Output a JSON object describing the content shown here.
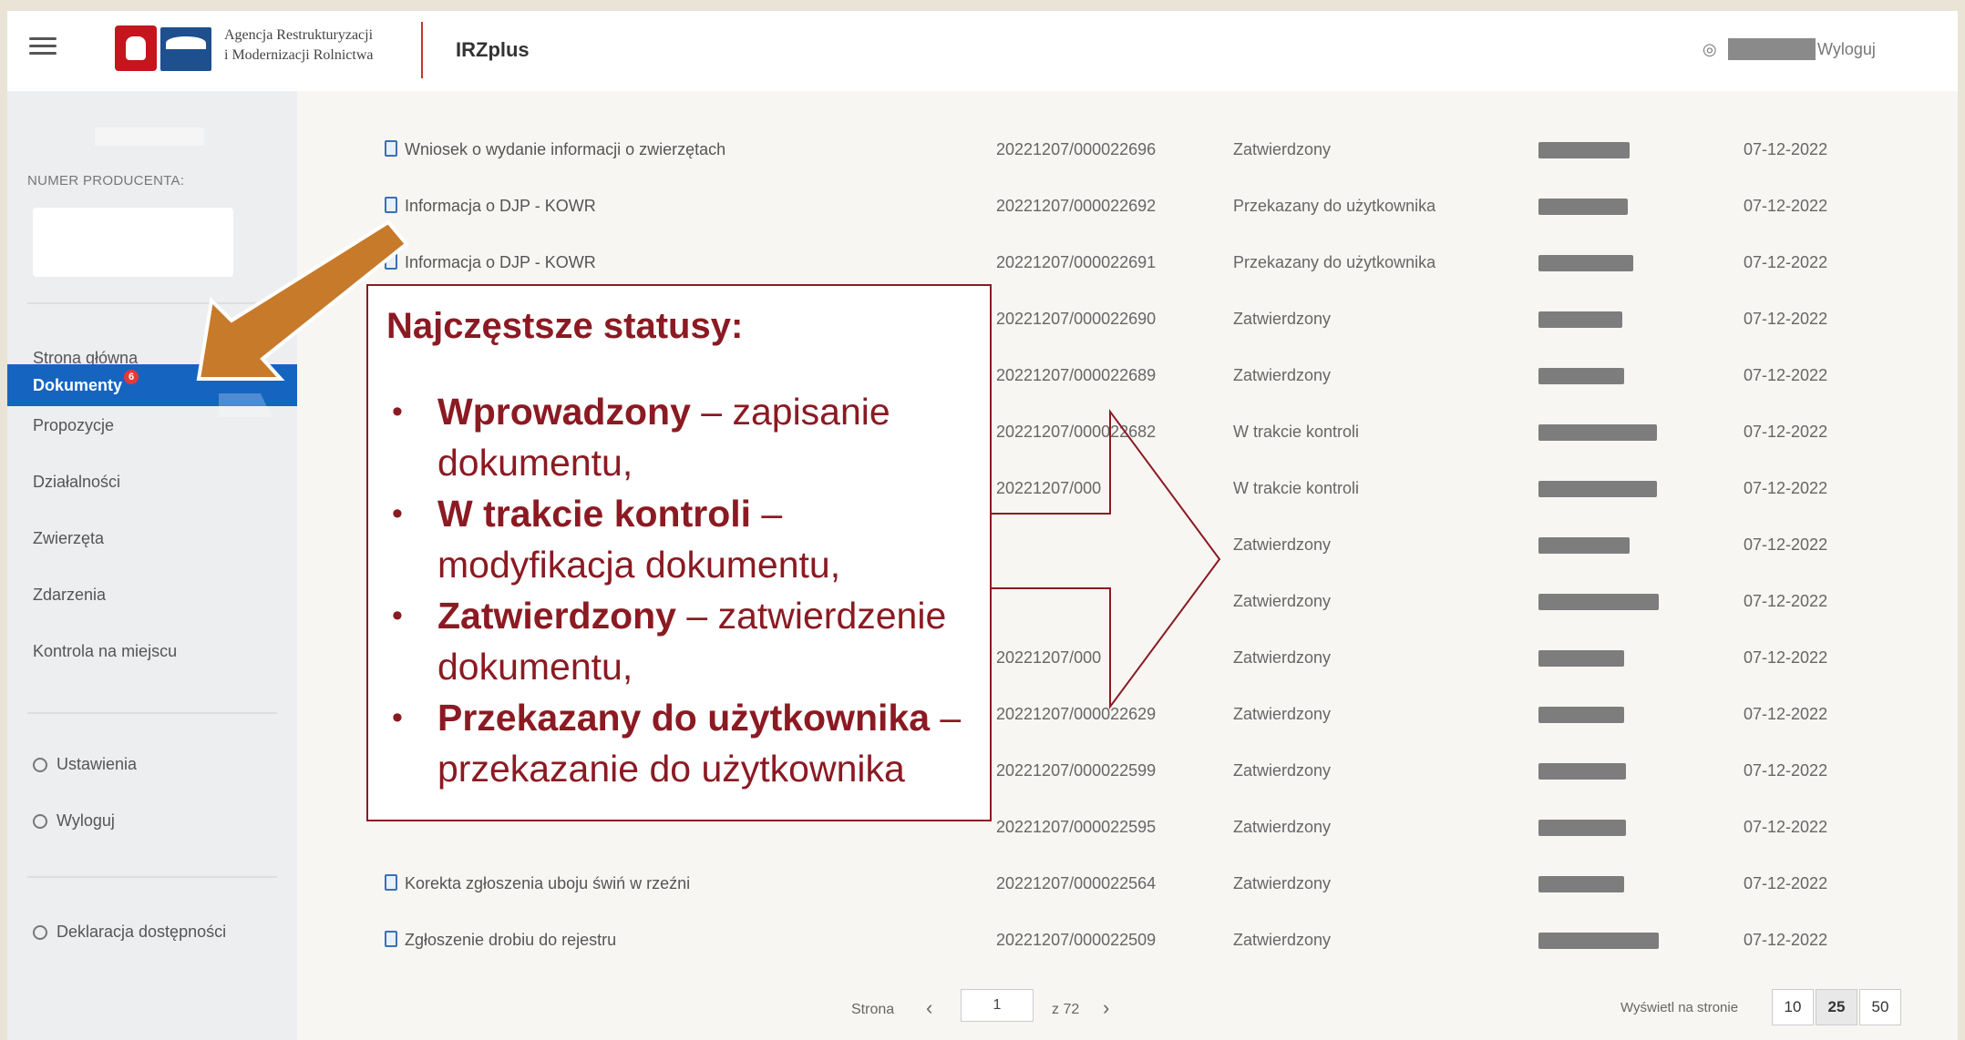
{
  "header": {
    "agency_line1": "Agencja Restrukturyzacji",
    "agency_line2": "i Modernizacji Rolnictwa",
    "app_name": "IRZplus",
    "logout": "Wyloguj"
  },
  "sidebar": {
    "producer_label": "NUMER PRODUCENTA:",
    "items": [
      {
        "label": "Strona główna"
      },
      {
        "label": "Dokumenty",
        "badge": "6"
      },
      {
        "label": "Propozycje"
      },
      {
        "label": "Działalności"
      },
      {
        "label": "Zwierzęta"
      },
      {
        "label": "Zdarzenia"
      },
      {
        "label": "Kontrola na miejscu"
      },
      {
        "label": "Ustawienia"
      },
      {
        "label": "Wyloguj"
      },
      {
        "label": "Deklaracja dostępności"
      }
    ]
  },
  "table": {
    "rows": [
      {
        "name": "Wniosek o wydanie informacji o zwierzętach",
        "number": "20221207/000022696",
        "status": "Zatwierdzony",
        "date": "07-12-2022"
      },
      {
        "name": "Informacja o DJP - KOWR",
        "number": "20221207/000022692",
        "status": "Przekazany do użytkownika",
        "date": "07-12-2022"
      },
      {
        "name": "Informacja o DJP - KOWR",
        "number": "20221207/000022691",
        "status": "Przekazany do użytkownika",
        "date": "07-12-2022"
      },
      {
        "name": "",
        "number": "20221207/000022690",
        "status": "Zatwierdzony",
        "date": "07-12-2022"
      },
      {
        "name": "",
        "number": "20221207/000022689",
        "status": "Zatwierdzony",
        "date": "07-12-2022"
      },
      {
        "name": "",
        "number": "20221207/000022682",
        "status": "W trakcie kontroli",
        "date": "07-12-2022"
      },
      {
        "name": "",
        "number": "20221207/000",
        "status": "W trakcie kontroli",
        "date": "07-12-2022"
      },
      {
        "name": "",
        "number": "",
        "status": "Zatwierdzony",
        "date": "07-12-2022"
      },
      {
        "name": "",
        "number": "",
        "status": "Zatwierdzony",
        "date": "07-12-2022"
      },
      {
        "name": "",
        "number": "20221207/000",
        "status": "Zatwierdzony",
        "date": "07-12-2022"
      },
      {
        "name": "",
        "number": "20221207/000022629",
        "status": "Zatwierdzony",
        "date": "07-12-2022"
      },
      {
        "name": "",
        "number": "20221207/000022599",
        "status": "Zatwierdzony",
        "date": "07-12-2022"
      },
      {
        "name": "",
        "number": "20221207/000022595",
        "status": "Zatwierdzony",
        "date": "07-12-2022"
      },
      {
        "name": "Korekta zgłoszenia uboju świń w rzeźni",
        "number": "20221207/000022564",
        "status": "Zatwierdzony",
        "date": "07-12-2022"
      },
      {
        "name": "Zgłoszenie drobiu do rejestru",
        "number": "20221207/000022509",
        "status": "Zatwierdzony",
        "date": "07-12-2022"
      }
    ]
  },
  "pagination": {
    "page_label": "Strona",
    "current_page": "1",
    "total": "z 72",
    "per_page_label": "Wyświetl na stronie",
    "options": [
      "10",
      "25",
      "50"
    ],
    "selected": "25"
  },
  "callout": {
    "title": "Najczęstsze statusy:",
    "items": [
      {
        "term": "Wprowadzony",
        "sep": " – ",
        "desc": "zapisanie dokumentu,"
      },
      {
        "term": "W trakcie kontroli",
        "sep": " – ",
        "desc": "modyfikacja dokumentu,"
      },
      {
        "term": "Zatwierdzony",
        "sep": " – ",
        "desc": "zatwierdzenie dokumentu,"
      },
      {
        "term": "Przekazany do użytkownika",
        "sep": " – ",
        "desc": "przekazanie do użytkownika"
      }
    ]
  },
  "colors": {
    "accent": "#1565c0",
    "callout": "#8b1a22",
    "arrow": "#c77a2a",
    "badge": "#e53935"
  }
}
